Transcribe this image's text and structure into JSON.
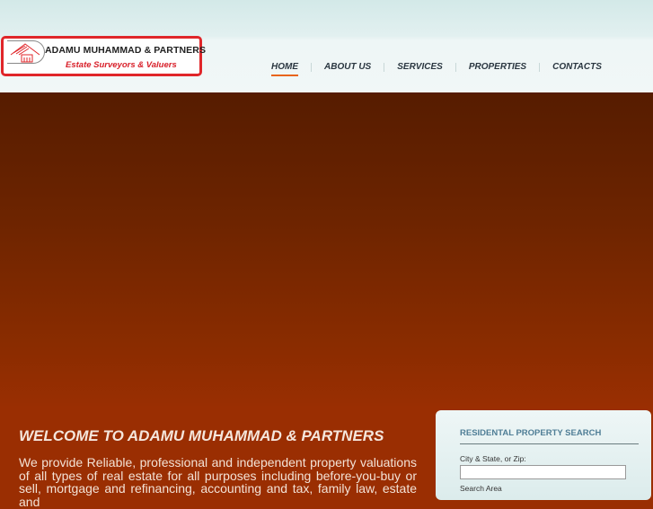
{
  "logo": {
    "name": "ADAMU MUHAMMAD & PARTNERS",
    "tagline": "Estate Surveyors & Valuers"
  },
  "nav": [
    {
      "label": "HOME",
      "active": true
    },
    {
      "label": "ABOUT US"
    },
    {
      "label": "SERVICES"
    },
    {
      "label": "PROPERTIES"
    },
    {
      "label": "CONTACTS"
    }
  ],
  "main": {
    "welcome": "WELCOME TO ADAMU MUHAMMAD & PARTNERS",
    "intro": "We provide Reliable, professional and independent property valuations of all types of real estate for all purposes including before-you-buy or sell, mortgage and refinancing, accounting and tax, family law, estate and"
  },
  "search": {
    "title": "RESIDENTAL PROPERTY SEARCH",
    "city_label": "City & State, or Zip:",
    "city_value": "",
    "area_label": "Search Area"
  },
  "colors": {
    "accent": "#e8641c",
    "logo_red": "#e0262a"
  }
}
